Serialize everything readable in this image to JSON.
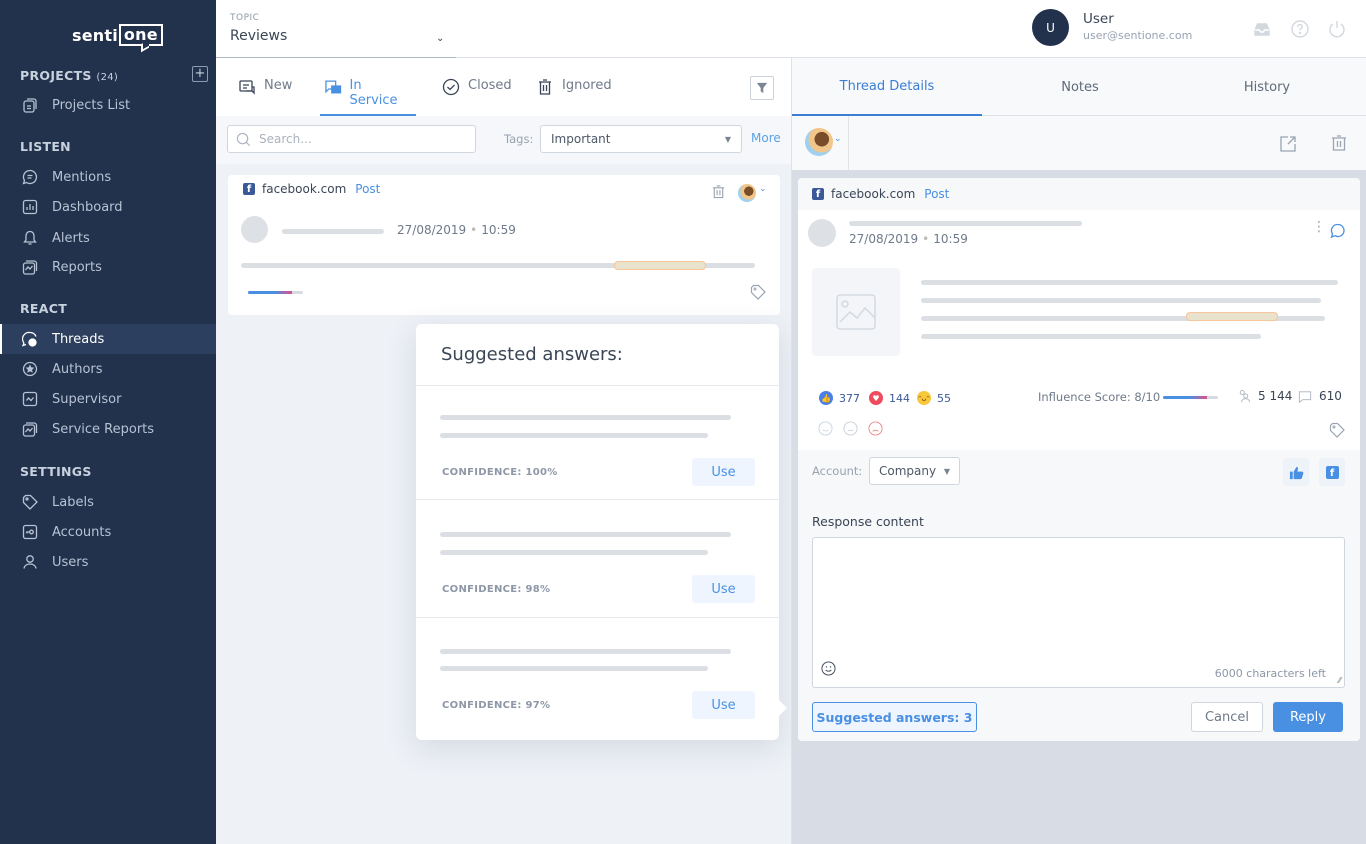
{
  "app": {
    "brand_left": "senti",
    "brand_right": "one"
  },
  "sidebar": {
    "projects_label": "PROJECTS",
    "projects_count": "(24)",
    "add_project": "+",
    "sections": [
      {
        "title": "LISTEN"
      },
      {
        "title": "REACT"
      },
      {
        "title": "SETTINGS"
      }
    ],
    "items": [
      {
        "label": "Projects List",
        "icon": "projects-list-icon"
      },
      {
        "label": "Mentions",
        "icon": "mentions-icon"
      },
      {
        "label": "Dashboard",
        "icon": "dashboard-icon"
      },
      {
        "label": "Alerts",
        "icon": "bell-icon"
      },
      {
        "label": "Reports",
        "icon": "reports-icon"
      },
      {
        "label": "Threads",
        "icon": "threads-icon",
        "active": true
      },
      {
        "label": "Authors",
        "icon": "authors-icon"
      },
      {
        "label": "Supervisor",
        "icon": "supervisor-icon"
      },
      {
        "label": "Service Reports",
        "icon": "service-reports-icon"
      },
      {
        "label": "Labels",
        "icon": "tag-icon"
      },
      {
        "label": "Accounts",
        "icon": "accounts-icon"
      },
      {
        "label": "Users",
        "icon": "user-icon"
      }
    ]
  },
  "topbar": {
    "topic_label": "TOPIC",
    "topic_value": "Reviews",
    "topic_arrow": "⌄",
    "user_initial": "U",
    "user_name": "User",
    "user_email": "user@sentione.com"
  },
  "threads": {
    "tabs": [
      {
        "label": "New"
      },
      {
        "label": "In Service",
        "active": true
      },
      {
        "label": "Closed"
      },
      {
        "label": "Ignored"
      }
    ],
    "search_placeholder": "Search...",
    "tags_label": "Tags:",
    "tags_value": "Important",
    "more_label": "More",
    "card": {
      "source": "facebook.com",
      "type": "Post",
      "date": "27/08/2019",
      "time": "10:59",
      "influence_fraction": 0.8
    }
  },
  "suggested": {
    "title": "Suggested answers:",
    "items": [
      {
        "confidence": "CONFIDENCE: 100%",
        "use": "Use"
      },
      {
        "confidence": "CONFIDENCE: 98%",
        "use": "Use"
      },
      {
        "confidence": "CONFIDENCE: 97%",
        "use": "Use"
      }
    ]
  },
  "details": {
    "tabs": [
      {
        "label": "Thread Details",
        "active": true
      },
      {
        "label": "Notes"
      },
      {
        "label": "History"
      }
    ],
    "source": "facebook.com",
    "type": "Post",
    "date": "27/08/2019",
    "time": "10:59",
    "reactions": {
      "like": "377",
      "love": "144",
      "haha": "55"
    },
    "influence_label": "Influence Score: 8/10",
    "influence_fraction": 0.8,
    "reach": "5 144",
    "comments": "610",
    "account_label": "Account:",
    "account_value": "Company",
    "response_label": "Response content",
    "response_value": "",
    "chars_left": "6000 characters left",
    "suggested_button": "Suggested answers: 3",
    "cancel": "Cancel",
    "reply": "Reply"
  },
  "colors": {
    "accent": "#4a90e2",
    "sidebar": "#22324d",
    "facebook": "#3b5998"
  }
}
